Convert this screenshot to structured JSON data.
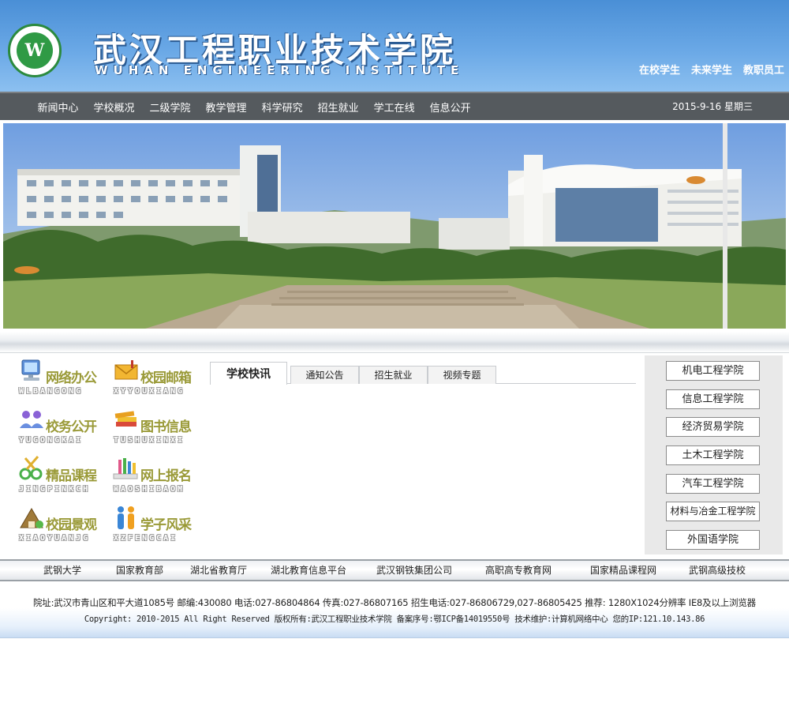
{
  "header": {
    "title_cn": "武汉工程职业技术学院",
    "title_en": "WUHAN ENGINEERING INSTITUTE",
    "logo_mark": "W",
    "quick_links": [
      "在校学生",
      "未来学生",
      "教职员工"
    ]
  },
  "nav": {
    "items": [
      "新闻中心",
      "学校概况",
      "二级学院",
      "教学管理",
      "科学研究",
      "招生就业",
      "学工在线",
      "信息公开"
    ],
    "date": "2015-9-16 星期三"
  },
  "icons": [
    {
      "cn": "网络办公",
      "pinyin": "WLBANGONG",
      "icon": "computer-icon",
      "color": "#4a7fc8"
    },
    {
      "cn": "校园邮箱",
      "pinyin": "XYYOUXIANG",
      "icon": "mail-icon",
      "color": "#e8a21a"
    },
    {
      "cn": "校务公开",
      "pinyin": "YUGONGKAI",
      "icon": "people-icon",
      "color": "#7a55c8"
    },
    {
      "cn": "图书信息",
      "pinyin": "TUSHUXINXI",
      "icon": "books-icon",
      "color": "#d9a020"
    },
    {
      "cn": "精品课程",
      "pinyin": "JINGPINKCH",
      "icon": "scissors-icon",
      "color": "#58b84a"
    },
    {
      "cn": "网上报名",
      "pinyin": "WAOSHIBAOM",
      "icon": "pencils-icon",
      "color": "#e05a8a"
    },
    {
      "cn": "校园景观",
      "pinyin": "XIAOYUANJG",
      "icon": "landscape-icon",
      "color": "#8a6a3a"
    },
    {
      "cn": "学子风采",
      "pinyin": "XZFENGCAI",
      "icon": "students-icon",
      "color": "#3a86d6"
    }
  ],
  "tabs": [
    "学校快讯",
    "通知公告",
    "招生就业",
    "视频专题"
  ],
  "colleges": [
    "机电工程学院",
    "信息工程学院",
    "经济贸易学院",
    "土木工程学院",
    "汽车工程学院",
    "材料与冶金工程学院",
    "外国语学院"
  ],
  "friend_links": [
    "武钢大学",
    "国家教育部",
    "湖北省教育厅",
    "湖北教育信息平台",
    "武汉钢铁集团公司",
    "高职高专教育网",
    "国家精品课程网",
    "武钢高级技校"
  ],
  "footer": {
    "line1": "院址:武汉市青山区和平大道1085号 邮编:430080 电话:027-86804864 传真:027-86807165 招生电话:027-86806729,027-86805425 推荐: 1280X1024分辨率 IE8及以上浏览器",
    "line2": "Copyright: 2010-2015 All Right Reserved 版权所有:武汉工程职业技术学院 备案序号:鄂ICP备14019550号 技术维护:计算机网络中心 您的IP:121.10.143.86"
  }
}
